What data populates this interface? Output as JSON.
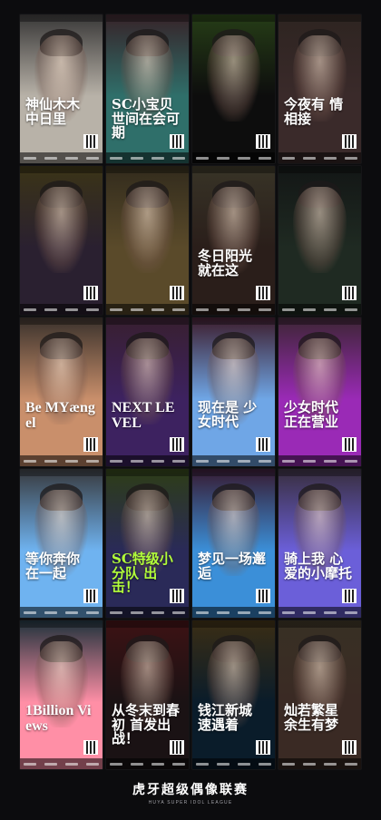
{
  "posters": [
    {
      "title": "神仙木木 中日里",
      "bg": "#b8b2a8",
      "accent": "#e9e4dc"
    },
    {
      "title": "SC小宝贝 世间在会可期",
      "bg": "#2f6f6a",
      "accent": "#e07f93"
    },
    {
      "title": "",
      "bg": "#0d0d0d",
      "accent": "#8dff3a"
    },
    {
      "title": "今夜有 情相接",
      "bg": "#3a2a2a",
      "accent": "#b4856c"
    },
    {
      "title": "",
      "bg": "#2a2030",
      "accent": "#f5d23a"
    },
    {
      "title": "",
      "bg": "#5a4a2a",
      "accent": "#c9a857"
    },
    {
      "title": "冬日阳光 就在这",
      "bg": "#2a1e1a",
      "accent": "#e7d28a"
    },
    {
      "title": "",
      "bg": "#1f2a22",
      "accent": "#2f3f33"
    },
    {
      "title": "Be MYængel",
      "bg": "#c98f6b",
      "accent": "#f0c7a2"
    },
    {
      "title": "NEXT LEVEL",
      "bg": "#3d2260",
      "accent": "#e86ab5"
    },
    {
      "title": "现在是 少女时代",
      "bg": "#6fa6e6",
      "accent": "#ff5fa8"
    },
    {
      "title": "少女时代 正在营业",
      "bg": "#9a2ab6",
      "accent": "#ff8ad0"
    },
    {
      "title": "等你奔你 在一起",
      "bg": "#6fb3f0",
      "accent": "#e7f1ff"
    },
    {
      "title": "SC特级小分队 出击！",
      "bg": "#2a2a58",
      "accent": "#b3ff3a"
    },
    {
      "title": "梦见一场邂逅",
      "bg": "#3b8fd8",
      "accent": "#e257c2"
    },
    {
      "title": "骑上我 心爱的小摩托",
      "bg": "#6b5fd9",
      "accent": "#e8b7ff"
    },
    {
      "title": "1Billion Views",
      "bg": "#ff8fa6",
      "accent": "#6fc9f0"
    },
    {
      "title": "从冬末到春初 首发出战！",
      "bg": "#1a1214",
      "accent": "#ff2b2b"
    },
    {
      "title": "钱江新城 速遇着",
      "bg": "#0a1c2a",
      "accent": "#f2b230"
    },
    {
      "title": "灿若繁星 余生有梦",
      "bg": "#3a2a24",
      "accent": "#e8c07a"
    }
  ],
  "brand": {
    "title": "虎牙超级偶像联赛",
    "subtitle": "HUYA SUPER IDOL LEAGUE"
  }
}
